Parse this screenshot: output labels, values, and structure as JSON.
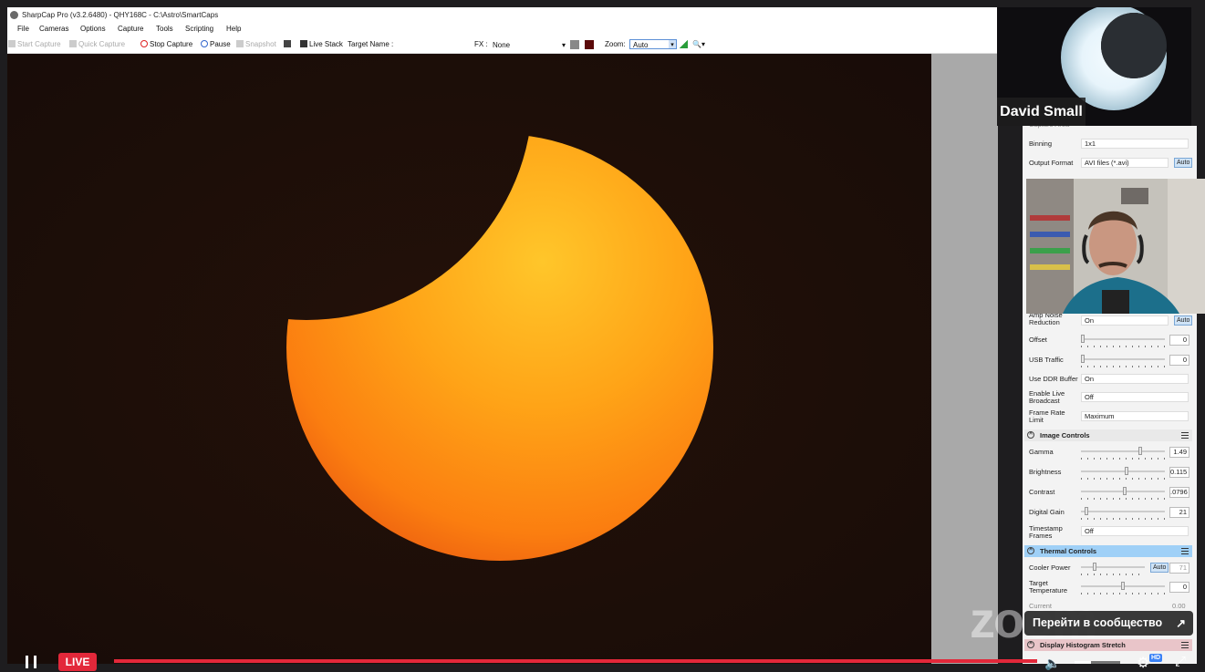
{
  "window": {
    "title": "SharpCap Pro (v3.2.6480) - QHY168C - C:\\Astro\\SmartCaps"
  },
  "menu": [
    "File",
    "Cameras",
    "Options",
    "Capture",
    "Tools",
    "Scripting",
    "Help"
  ],
  "toolbar": {
    "start_capture": "Start Capture",
    "quick_capture": "Quick Capture",
    "stop_capture": "Stop Capture",
    "pause": "Pause",
    "snapshot": "Snapshot",
    "live_stack": "Live Stack",
    "target_name_label": "Target Name :",
    "fx_label": "FX :",
    "fx_value": "None",
    "zoom_label": "Zoom:",
    "zoom_value": "Auto"
  },
  "panel": {
    "capture_area_label": "Capture Area",
    "binning_label": "Binning",
    "binning_value": "1x1",
    "output_format_label": "Output Format",
    "output_format_value": "AVI files (*.avi)",
    "auto_label": "Auto",
    "amp_noise_label": "Amp Noise Reduction",
    "amp_noise_value": "On",
    "offset_label": "Offset",
    "offset_value": "0",
    "usb_traffic_label": "USB Traffic",
    "usb_traffic_value": "0",
    "ddr_buffer_label": "Use DDR Buffer",
    "ddr_buffer_value": "On",
    "live_broadcast_label": "Enable Live Broadcast",
    "live_broadcast_value": "Off",
    "frame_rate_label": "Frame Rate Limit",
    "frame_rate_value": "Maximum",
    "image_controls_header": "Image Controls",
    "gamma_label": "Gamma",
    "gamma_value": "1.49",
    "brightness_label": "Brightness",
    "brightness_value": "0.115",
    "contrast_label": "Contrast",
    "contrast_value": ".0796",
    "digital_gain_label": "Digital Gain",
    "digital_gain_value": "21",
    "timestamp_label": "Timestamp Frames",
    "timestamp_value": "Off",
    "thermal_header": "Thermal Controls",
    "cooler_power_label": "Cooler Power",
    "cooler_power_value": "71",
    "target_temp_label": "Target Temperature",
    "target_temp_value": "0",
    "current_label": "Current",
    "current_value": "0.00",
    "histogram_header": "Display Histogram Stretch"
  },
  "sliders": {
    "offset": 0.0,
    "usb_traffic": 0.0,
    "gamma": 0.72,
    "brightness": 0.55,
    "contrast": 0.52,
    "digital_gain": 0.05,
    "cooler_power": 0.2,
    "target_temp": 0.5
  },
  "participant": {
    "name": "David Small"
  },
  "player": {
    "live_label": "LIVE",
    "community_button": "Перейти в сообщество",
    "hd_badge": "HD",
    "watermark": "zoom"
  },
  "colors": {
    "sun_center": "#ffb21e",
    "sun_edge": "#f0670c",
    "sky": "#1d0f0a",
    "live_red": "#e3283a"
  }
}
